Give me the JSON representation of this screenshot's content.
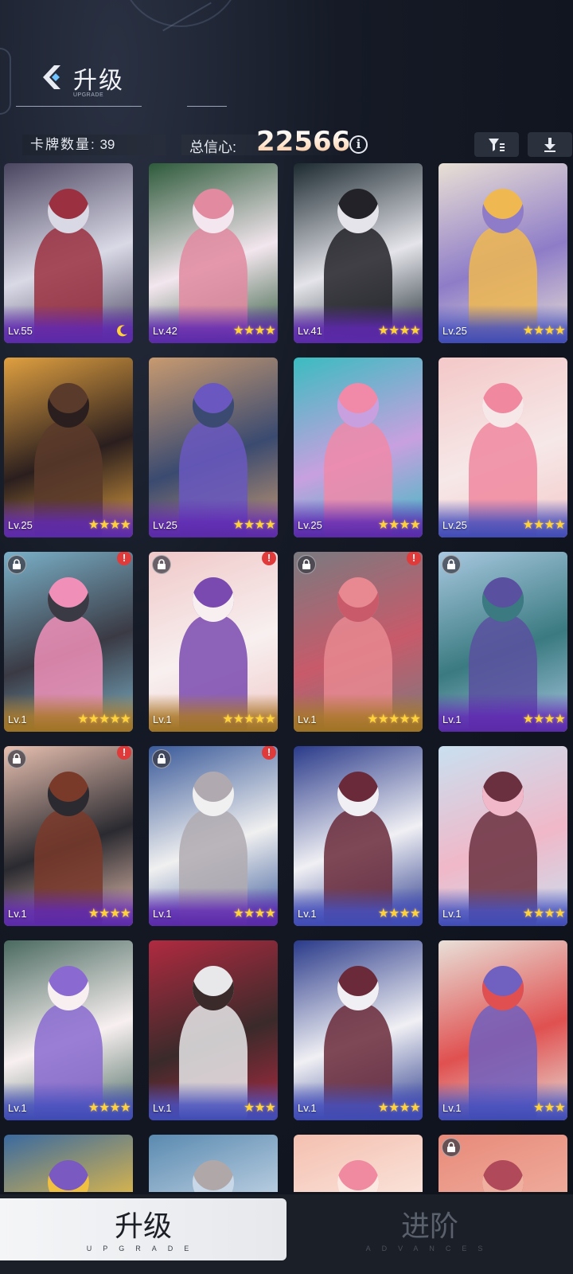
{
  "header": {
    "title": "升级",
    "subtitle": "UPGRADE"
  },
  "stats": {
    "card_count_label": "卡牌数量:",
    "card_count_value": "39",
    "confidence_label": "总信心:",
    "confidence_value": "22566",
    "info_glyph": "i"
  },
  "toolbar": {
    "filter_icon": "filter-icon",
    "download_icon": "download-icon"
  },
  "cards": [
    {
      "level": "Lv.55",
      "stars": "",
      "moon": true,
      "rarity": "purple",
      "locked": false,
      "alert": false,
      "palette": [
        "#4a4560",
        "#9a3040",
        "#d9d9e6"
      ]
    },
    {
      "level": "Lv.42",
      "stars": "★★★★",
      "moon": false,
      "rarity": "purple",
      "locked": false,
      "alert": false,
      "palette": [
        "#2d5a3a",
        "#e28aa0",
        "#f3e6ee"
      ]
    },
    {
      "level": "Lv.41",
      "stars": "★★★★",
      "moon": false,
      "rarity": "purple",
      "locked": false,
      "alert": false,
      "palette": [
        "#1c2a30",
        "#222228",
        "#e4e4ea"
      ]
    },
    {
      "level": "Lv.25",
      "stars": "★★★★",
      "moon": false,
      "rarity": "blue",
      "locked": false,
      "alert": false,
      "palette": [
        "#e9e0d4",
        "#f0b850",
        "#8e7cc8"
      ]
    },
    {
      "level": "Lv.25",
      "stars": "★★★★",
      "moon": false,
      "rarity": "purple",
      "locked": false,
      "alert": false,
      "palette": [
        "#e0a040",
        "#5a3a2a",
        "#2a1e1e"
      ]
    },
    {
      "level": "Lv.25",
      "stars": "★★★★",
      "moon": false,
      "rarity": "purple",
      "locked": false,
      "alert": false,
      "palette": [
        "#c89a70",
        "#6a58c0",
        "#3a4a70"
      ]
    },
    {
      "level": "Lv.25",
      "stars": "★★★★",
      "moon": false,
      "rarity": "purple",
      "locked": false,
      "alert": false,
      "palette": [
        "#3abcc0",
        "#f08aa8",
        "#c8a0e0"
      ]
    },
    {
      "level": "Lv.25",
      "stars": "★★★★",
      "moon": false,
      "rarity": "blue",
      "locked": false,
      "alert": false,
      "palette": [
        "#f4c8c8",
        "#f088a0",
        "#f6e8e8"
      ]
    },
    {
      "level": "Lv.1",
      "stars": "★★★★★",
      "moon": false,
      "rarity": "gold",
      "locked": true,
      "alert": true,
      "palette": [
        "#7ab0c8",
        "#f090b8",
        "#3a3a44"
      ]
    },
    {
      "level": "Lv.1",
      "stars": "★★★★★",
      "moon": false,
      "rarity": "gold",
      "locked": true,
      "alert": true,
      "palette": [
        "#f0c8c8",
        "#7a4ab0",
        "#f8f0f0"
      ]
    },
    {
      "level": "Lv.1",
      "stars": "★★★★★",
      "moon": false,
      "rarity": "gold",
      "locked": true,
      "alert": true,
      "palette": [
        "#7a7a80",
        "#e88890",
        "#c85a6a"
      ]
    },
    {
      "level": "Lv.1",
      "stars": "★★★★",
      "moon": false,
      "rarity": "purple",
      "locked": true,
      "alert": false,
      "palette": [
        "#a8c8e0",
        "#5a50a0",
        "#3a7a80"
      ]
    },
    {
      "level": "Lv.1",
      "stars": "★★★★",
      "moon": false,
      "rarity": "purple",
      "locked": true,
      "alert": true,
      "palette": [
        "#e8c0b0",
        "#7a3a2a",
        "#2a2a30"
      ]
    },
    {
      "level": "Lv.1",
      "stars": "★★★★",
      "moon": false,
      "rarity": "purple",
      "locked": true,
      "alert": true,
      "palette": [
        "#3a5a9a",
        "#b0aab0",
        "#f0f0f0"
      ]
    },
    {
      "level": "Lv.1",
      "stars": "★★★★",
      "moon": false,
      "rarity": "blue",
      "locked": false,
      "alert": false,
      "palette": [
        "#2a3a8a",
        "#6a2a3a",
        "#f0f0f4"
      ]
    },
    {
      "level": "Lv.1",
      "stars": "★★★★",
      "moon": false,
      "rarity": "blue",
      "locked": false,
      "alert": false,
      "palette": [
        "#c8e0f0",
        "#6a3040",
        "#f0b8c8"
      ]
    },
    {
      "level": "Lv.1",
      "stars": "★★★★",
      "moon": false,
      "rarity": "blue",
      "locked": false,
      "alert": false,
      "palette": [
        "#4a6a60",
        "#8a6ad0",
        "#f8f0f0"
      ]
    },
    {
      "level": "Lv.1",
      "stars": "★★★",
      "moon": false,
      "rarity": "blue",
      "locked": false,
      "alert": false,
      "palette": [
        "#b02a40",
        "#e8e8ea",
        "#3a2a2a"
      ]
    },
    {
      "level": "Lv.1",
      "stars": "★★★★",
      "moon": false,
      "rarity": "blue",
      "locked": false,
      "alert": false,
      "palette": [
        "#2a3a8a",
        "#6a2a3a",
        "#f0f0f4"
      ]
    },
    {
      "level": "Lv.1",
      "stars": "★★★",
      "moon": false,
      "rarity": "blue",
      "locked": false,
      "alert": false,
      "palette": [
        "#e8e0d8",
        "#7060c0",
        "#e05050"
      ]
    },
    {
      "level": "",
      "stars": "",
      "moon": false,
      "rarity": "none",
      "locked": false,
      "alert": false,
      "palette": [
        "#3a6aa0",
        "#7a5ac0",
        "#f0c040"
      ]
    },
    {
      "level": "",
      "stars": "",
      "moon": false,
      "rarity": "none",
      "locked": false,
      "alert": false,
      "palette": [
        "#5a8ab0",
        "#b0a8a8",
        "#c8d8e8"
      ]
    },
    {
      "level": "",
      "stars": "",
      "moon": false,
      "rarity": "none",
      "locked": false,
      "alert": false,
      "palette": [
        "#f4c0b0",
        "#f08aa0",
        "#fbe8e0"
      ]
    },
    {
      "level": "",
      "stars": "",
      "moon": false,
      "rarity": "none",
      "locked": true,
      "alert": false,
      "palette": [
        "#e88a7a",
        "#b04a5a",
        "#f0b0a0"
      ]
    }
  ],
  "tabs": [
    {
      "label": "升级",
      "sub": "UPGRADE",
      "active": true
    },
    {
      "label": "进阶",
      "sub": "ADVANCES",
      "active": false
    }
  ]
}
